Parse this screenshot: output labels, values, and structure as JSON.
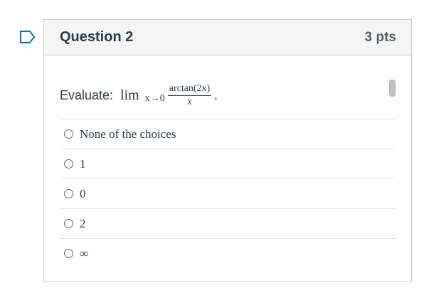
{
  "question": {
    "title": "Question 2",
    "points": "3 pts",
    "prompt_label": "Evaluate:",
    "math": {
      "lim": "lim",
      "subscript": "x→0",
      "numerator": "arctan(2x)",
      "denominator": "x",
      "end": "."
    },
    "choices": [
      {
        "label": "None of the choices"
      },
      {
        "label": "1"
      },
      {
        "label": "0"
      },
      {
        "label": "2"
      },
      {
        "label": "∞"
      }
    ]
  },
  "icons": {
    "flag": "flag-outline-icon"
  },
  "colors": {
    "accent": "#0374b5",
    "header_bg": "#f5f5f5",
    "border": "#c7cdd1",
    "text": "#2d3b45"
  }
}
